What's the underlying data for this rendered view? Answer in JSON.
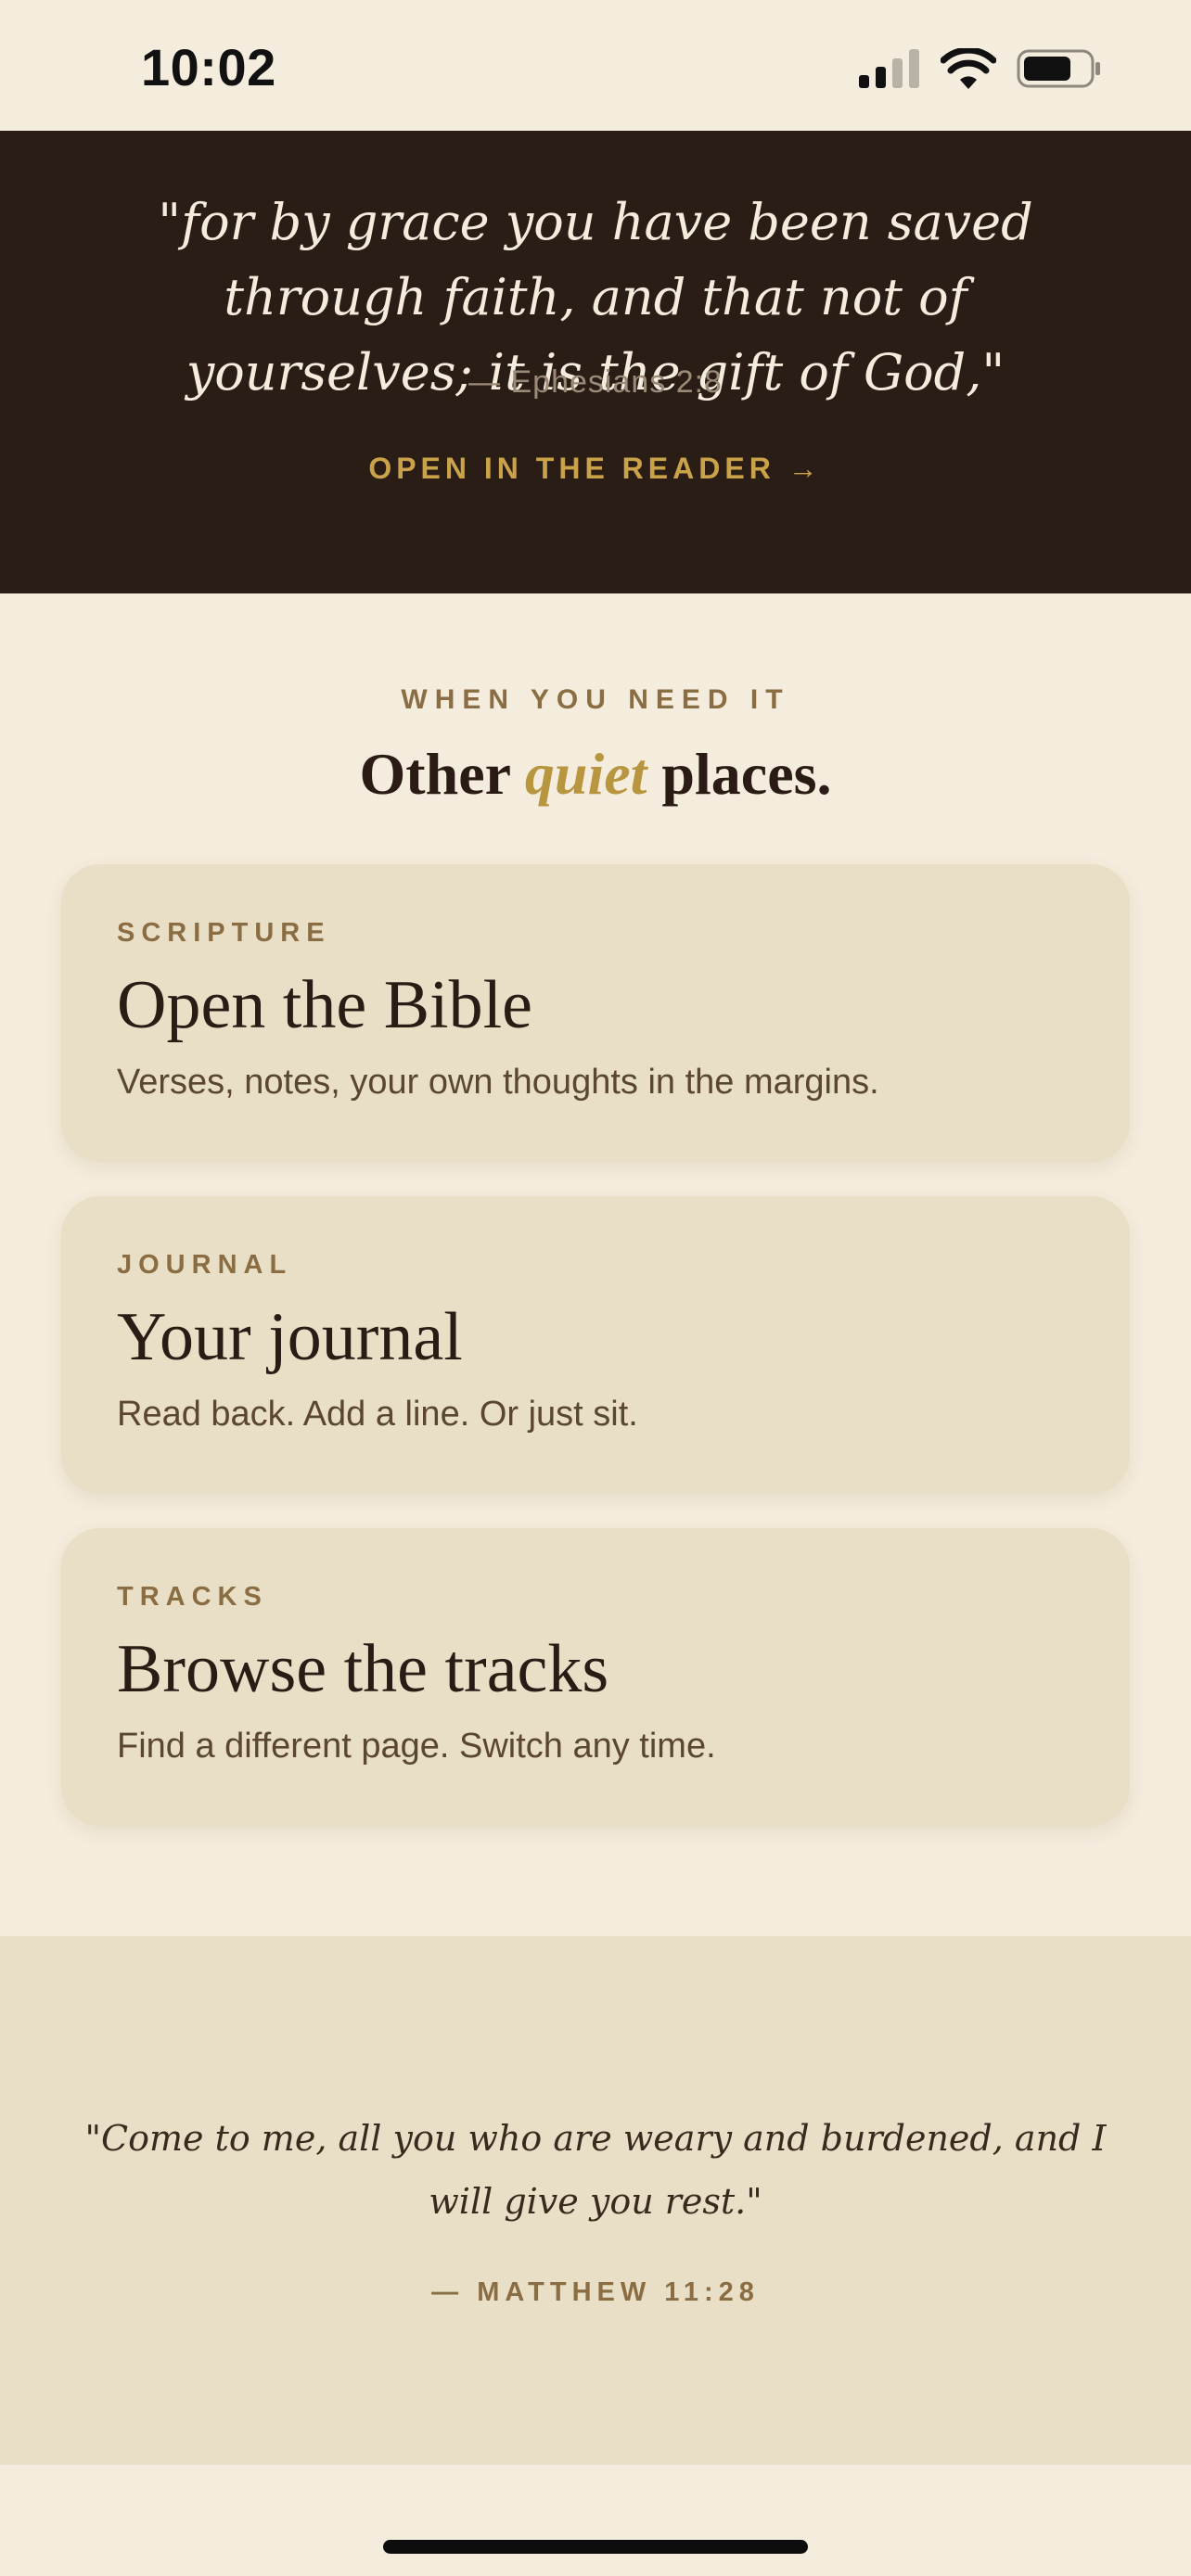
{
  "status_bar": {
    "time": "10:02",
    "icons": [
      "cellular-signal-icon",
      "wifi-icon",
      "battery-icon"
    ]
  },
  "hero": {
    "quote": "\"for by grace you have been saved through faith, and that not of yourselves; it is the gift of God,\"",
    "reference": "— Ephesians 2:8",
    "link_label": "OPEN IN THE READER →"
  },
  "section": {
    "eyebrow": "WHEN YOU NEED IT",
    "title_before": "Other ",
    "title_accent": "quiet",
    "title_after": " places."
  },
  "cards": [
    {
      "eyebrow": "SCRIPTURE",
      "title": "Open the Bible",
      "description": "Verses, notes, your own thoughts in the margins."
    },
    {
      "eyebrow": "JOURNAL",
      "title": "Your journal",
      "description": "Read back. Add a line. Or just sit."
    },
    {
      "eyebrow": "TRACKS",
      "title": "Browse the tracks",
      "description": "Find a different page. Switch any time."
    }
  ],
  "footer": {
    "quote": "\"Come to me, all you who are weary and burdened, and I will give you rest.\"",
    "reference": "— MATTHEW 11:28"
  },
  "colors": {
    "background": "#f4ecdd",
    "hero_background": "#2a1d15",
    "card_background": "#e9dfc6",
    "accent_gold": "#c9a24a",
    "eyebrow_brown": "#8a6d43",
    "text_dark": "#2a1c14"
  }
}
